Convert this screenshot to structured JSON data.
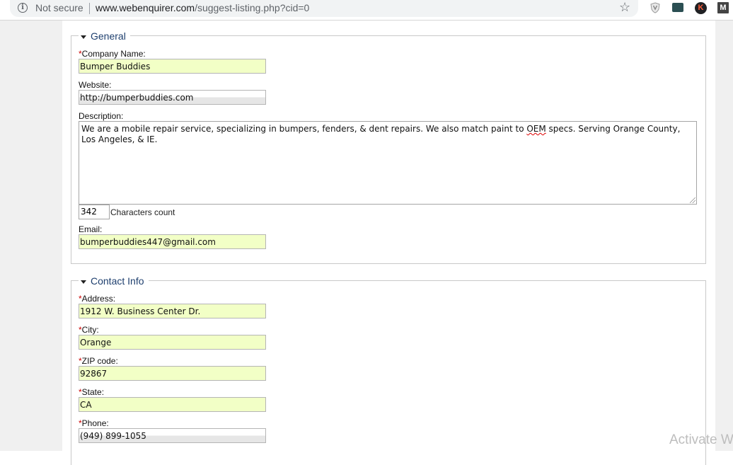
{
  "browser": {
    "security_label": "Not secure",
    "url_host": "www.webenquirer.com",
    "url_path": "/suggest-listing.php?cid=0",
    "extensions": [
      "shield-extension",
      "folder-extension",
      "k-extension",
      "m-extension"
    ],
    "ext_k_text": "K",
    "ext_m_text": "M"
  },
  "general": {
    "legend": "General",
    "company_name_label": "Company Name:",
    "company_name_value": "Bumper Buddies",
    "website_label": "Website:",
    "website_value": "http://bumperbuddies.com",
    "description_label": "Description:",
    "description_before": "We are a mobile repair service, specializing in bumpers, fenders, & dent repairs. We also match paint to ",
    "description_oem": "OEM",
    "description_after": " specs. Serving Orange County, Los Angeles, & IE.",
    "characters_count_value": "342",
    "characters_count_label": "Characters count",
    "email_label": "Email:",
    "email_value": "bumperbuddies447@gmail.com"
  },
  "contact": {
    "legend": "Contact Info",
    "address_label": "Address:",
    "address_value": "1912 W. Business Center Dr.",
    "city_label": "City:",
    "city_value": "Orange",
    "zip_label": "ZIP code:",
    "zip_value": "92867",
    "state_label": "State:",
    "state_value": "CA",
    "phone_label": "Phone:",
    "phone_value": "(949) 899-1055"
  },
  "required_marker": "*",
  "watermark": "Activate W",
  "colors": {
    "required_field_bg": "#f2ffc6",
    "legend_text": "#1e3f6e",
    "required_star": "#cc0000",
    "page_bg": "#f0f0f0"
  }
}
